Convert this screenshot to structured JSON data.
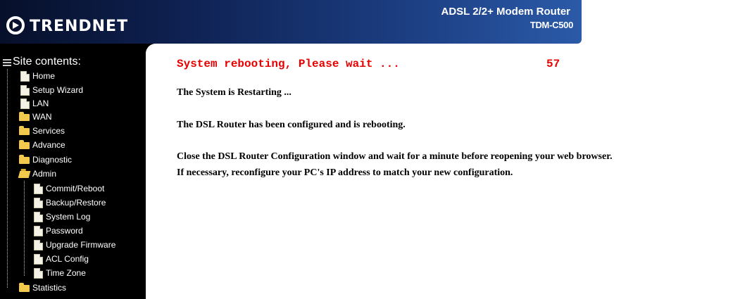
{
  "header": {
    "brand": "TRENDNET",
    "product_line": "ADSL 2/2+ Modem Router",
    "model": "TDM-C500"
  },
  "sidebar": {
    "title": "Site contents:",
    "items": [
      {
        "label": "Home",
        "icon": "document-icon"
      },
      {
        "label": "Setup Wizard",
        "icon": "document-icon"
      },
      {
        "label": "LAN",
        "icon": "document-icon"
      },
      {
        "label": "WAN",
        "icon": "folder-icon"
      },
      {
        "label": "Services",
        "icon": "folder-icon"
      },
      {
        "label": "Advance",
        "icon": "folder-icon"
      },
      {
        "label": "Diagnostic",
        "icon": "folder-icon"
      },
      {
        "label": "Admin",
        "icon": "folder-open-icon"
      },
      {
        "label": "Statistics",
        "icon": "folder-icon"
      }
    ],
    "admin_children": [
      {
        "label": "Commit/Reboot"
      },
      {
        "label": "Backup/Restore"
      },
      {
        "label": "System Log"
      },
      {
        "label": "Password"
      },
      {
        "label": "Upgrade Firmware"
      },
      {
        "label": "ACL Config"
      },
      {
        "label": "Time Zone"
      }
    ]
  },
  "main": {
    "status": "System rebooting, Please wait ...",
    "countdown": "57",
    "line1": "The System is Restarting ...",
    "line2": "The DSL Router has been configured and is rebooting.",
    "line3": "Close the DSL Router Configuration window and wait for a minute before reopening your web browser.",
    "line4": "If necessary, reconfigure your PC's IP address to match your new configuration."
  },
  "colors": {
    "status_red": "#e60000",
    "banner_dark": "#07102a",
    "banner_light": "#2b5aa8",
    "folder_yellow": "#f2c94c"
  }
}
